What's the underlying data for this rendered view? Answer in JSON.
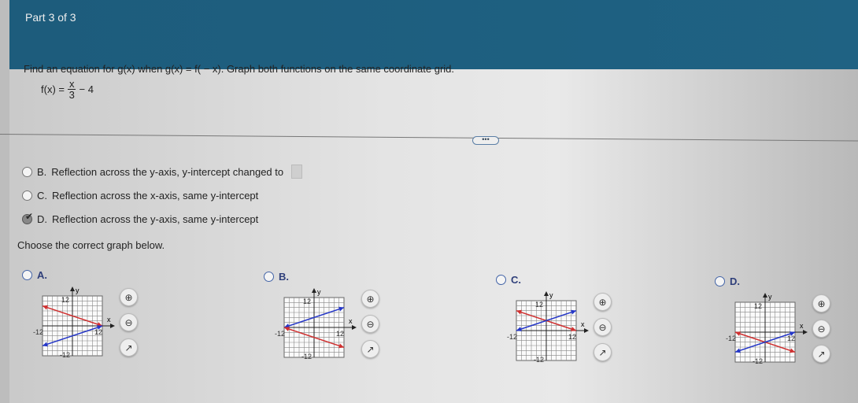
{
  "header": {
    "part": "Part 3 of 3"
  },
  "question": {
    "prompt_start": "Find an equation for g(x) when g(x) = f( − x). Graph both functions on the same coordinate grid.",
    "f_lhs": "f(x) =",
    "f_num": "x",
    "f_den": "3",
    "f_rest": "− 4"
  },
  "more_button": "•••",
  "answer_options": [
    {
      "letter": "B.",
      "text": "Reflection across the y-axis, y-intercept changed to",
      "selected": false,
      "has_input": true
    },
    {
      "letter": "C.",
      "text": "Reflection across the x-axis, same y-intercept",
      "selected": false
    },
    {
      "letter": "D.",
      "text": "Reflection across the y-axis, same y-intercept",
      "selected": true
    }
  ],
  "choose_prompt": "Choose the correct graph below.",
  "colors": {
    "header": "#1d5c7c",
    "red_line": "#d03030",
    "blue_line": "#2436c8"
  },
  "graphs": [
    {
      "letter": "A.",
      "axis_x": "x",
      "axis_y": "y",
      "tick_max": "12",
      "tick_min": "-12",
      "range": [
        -12,
        12
      ],
      "lines": [
        {
          "color": "red",
          "from": [
            -12,
            8
          ],
          "to": [
            12,
            0
          ]
        },
        {
          "color": "blue",
          "from": [
            -12,
            -8
          ],
          "to": [
            12,
            0
          ]
        }
      ]
    },
    {
      "letter": "B.",
      "axis_x": "x",
      "axis_y": "y",
      "tick_max": "12",
      "tick_min": "-12",
      "range": [
        -12,
        12
      ],
      "lines": [
        {
          "color": "blue",
          "from": [
            -12,
            0
          ],
          "to": [
            12,
            8
          ]
        },
        {
          "color": "red",
          "from": [
            -12,
            0
          ],
          "to": [
            12,
            -8
          ]
        }
      ]
    },
    {
      "letter": "C.",
      "axis_x": "x",
      "axis_y": "y",
      "tick_max": "12",
      "tick_min": "-12",
      "range": [
        -12,
        12
      ],
      "lines": [
        {
          "color": "red",
          "from": [
            -12,
            8
          ],
          "to": [
            12,
            0
          ]
        },
        {
          "color": "blue",
          "from": [
            -12,
            0
          ],
          "to": [
            12,
            8
          ]
        }
      ]
    },
    {
      "letter": "D.",
      "axis_x": "x",
      "axis_y": "y",
      "tick_max": "12",
      "tick_min": "-12",
      "range": [
        -12,
        12
      ],
      "lines": [
        {
          "color": "red",
          "from": [
            -12,
            0
          ],
          "to": [
            12,
            -8
          ]
        },
        {
          "color": "blue",
          "from": [
            -12,
            -8
          ],
          "to": [
            12,
            0
          ]
        }
      ]
    }
  ],
  "tools": {
    "zoom_in": "zoom-in-icon",
    "zoom_out": "zoom-out-icon",
    "popout": "external-link-icon"
  }
}
